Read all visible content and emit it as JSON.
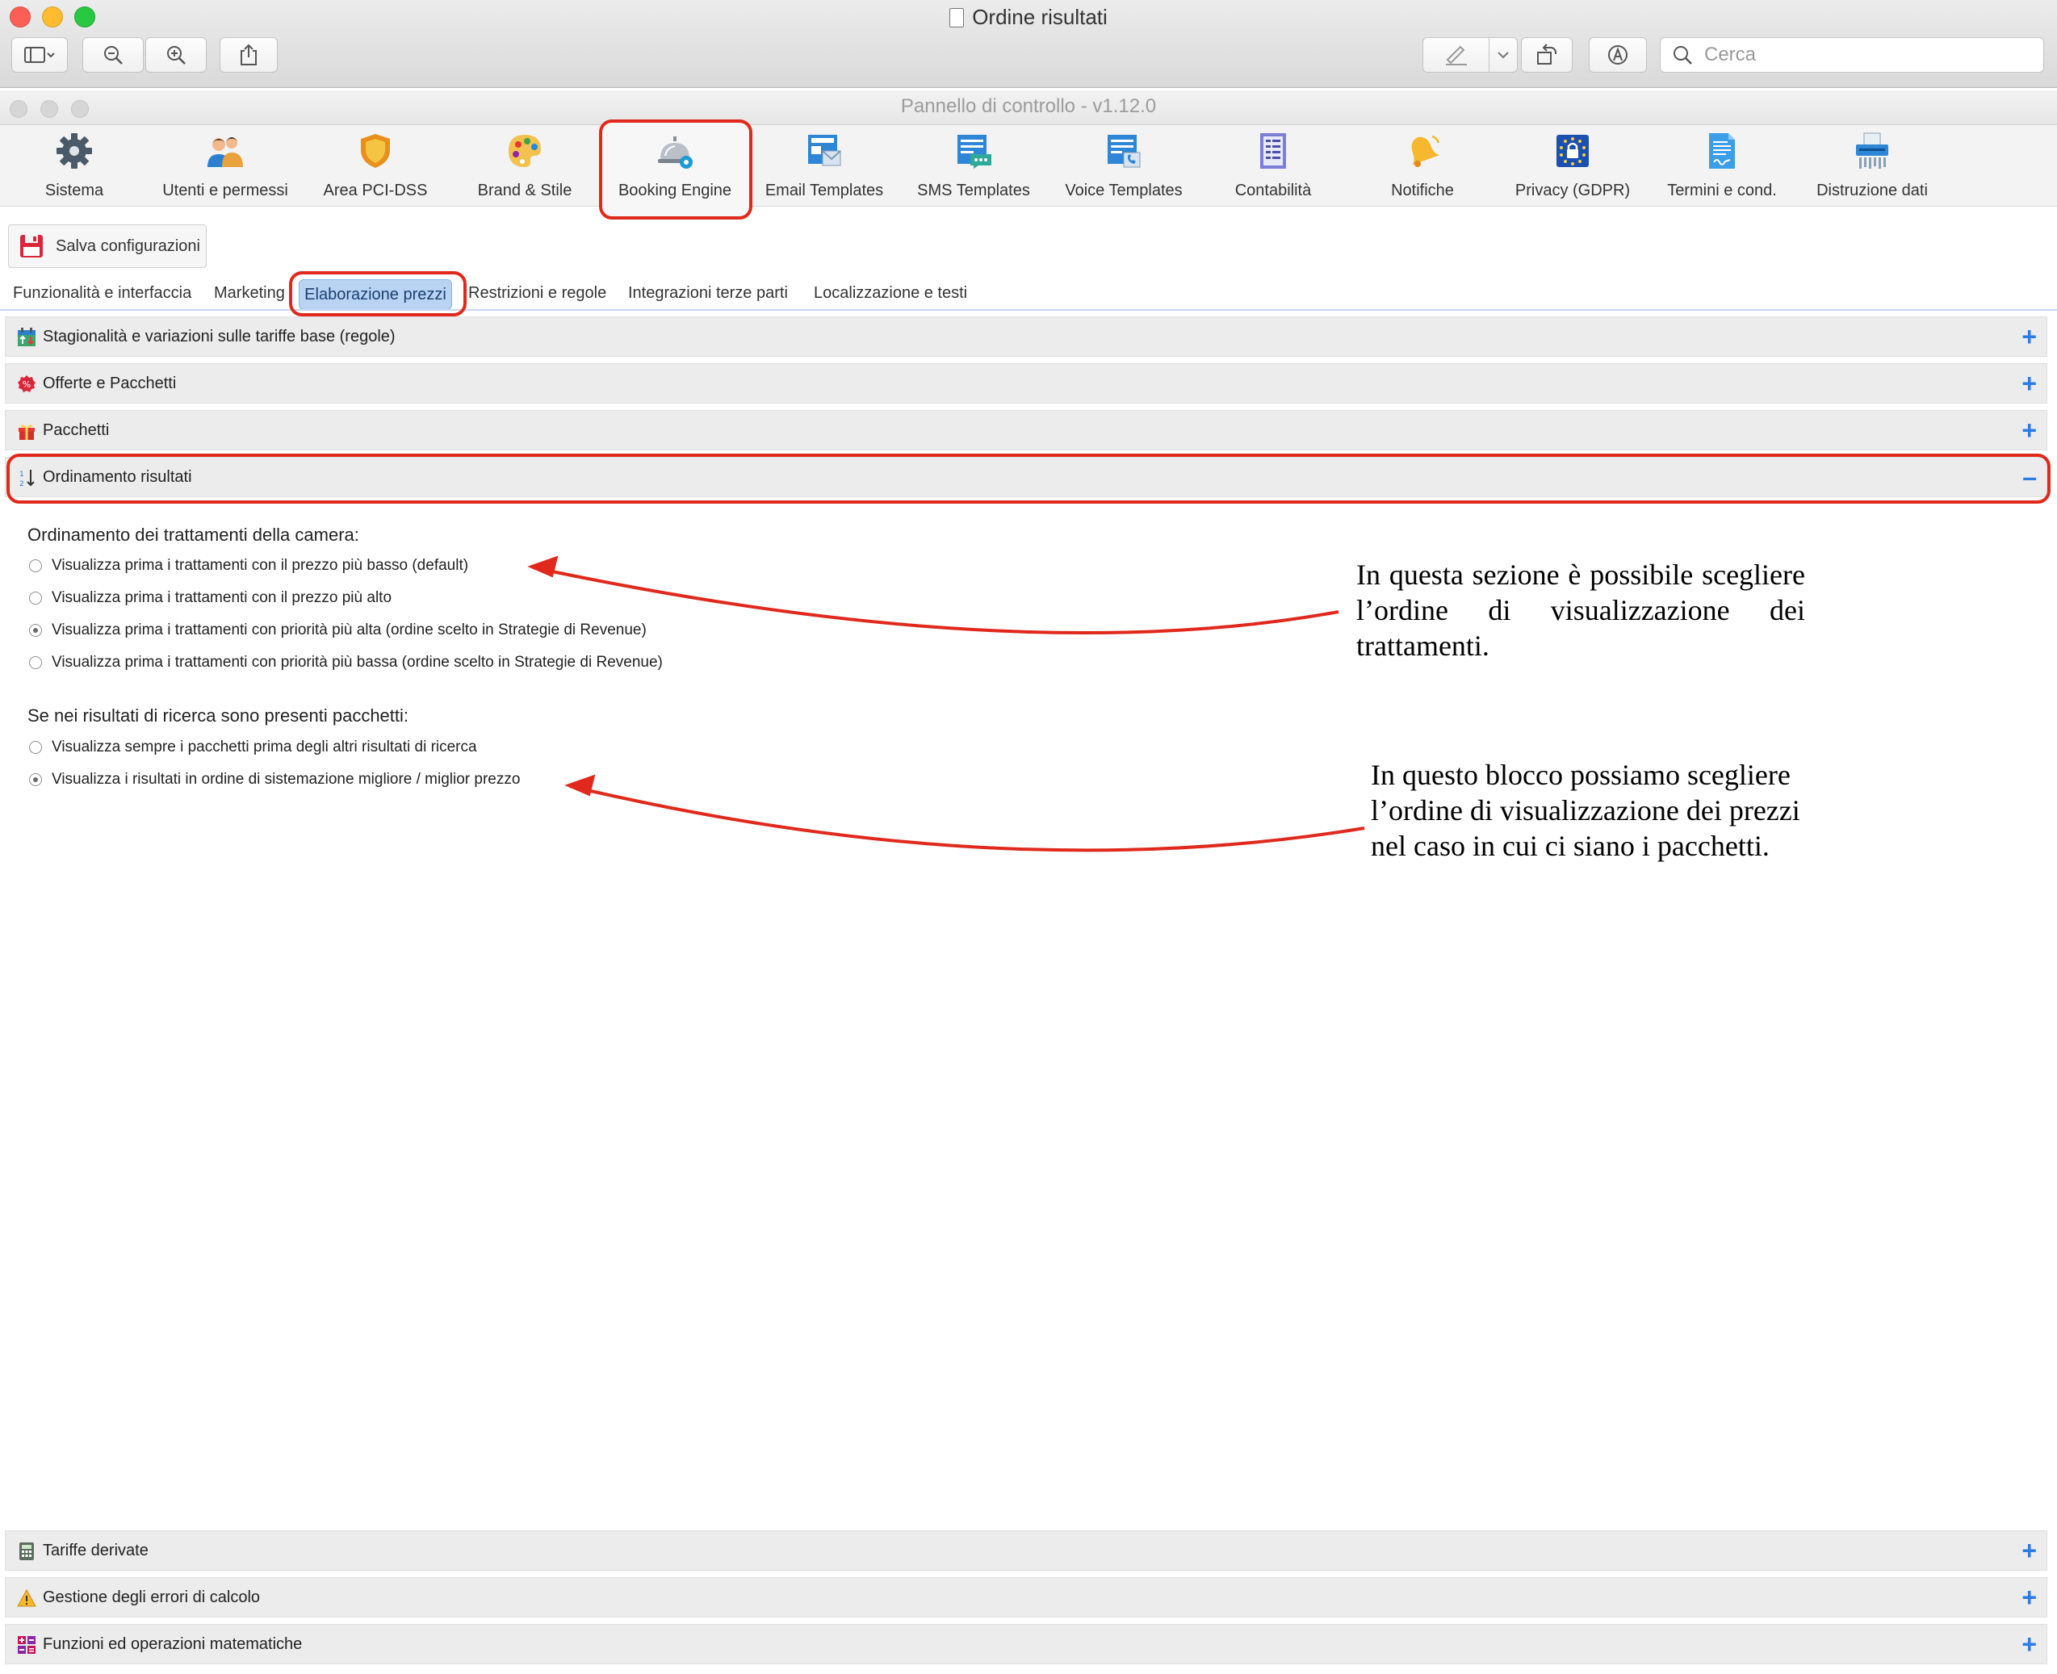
{
  "window": {
    "title": "Ordine risultati",
    "search_placeholder": "Cerca"
  },
  "app": {
    "title": "Pannello di controllo - v1.12.0",
    "toolbar": [
      {
        "label": "Sistema",
        "icon": "gear-icon"
      },
      {
        "label": "Utenti e permessi",
        "icon": "users-icon"
      },
      {
        "label": "Area PCI-DSS",
        "icon": "shield-icon"
      },
      {
        "label": "Brand & Stile",
        "icon": "palette-icon"
      },
      {
        "label": "Booking Engine",
        "icon": "service-bell-icon"
      },
      {
        "label": "Email Templates",
        "icon": "email-template-icon"
      },
      {
        "label": "SMS Templates",
        "icon": "sms-template-icon"
      },
      {
        "label": "Voice Templates",
        "icon": "voice-template-icon"
      },
      {
        "label": "Contabilità",
        "icon": "ledger-icon"
      },
      {
        "label": "Notifiche",
        "icon": "bell-icon"
      },
      {
        "label": "Privacy (GDPR)",
        "icon": "gdpr-lock-icon"
      },
      {
        "label": "Termini e cond.",
        "icon": "document-icon"
      },
      {
        "label": "Distruzione dati",
        "icon": "shredder-icon"
      }
    ],
    "save_label": "Salva configurazioni",
    "tabs": [
      "Funzionalità e interfaccia",
      "Marketing",
      "Elaborazione prezzi",
      "Restrizioni e regole",
      "Integrazioni terze parti",
      "Localizzazione e testi"
    ],
    "active_tab": "Elaborazione prezzi",
    "sections_top": [
      {
        "label": "Stagionalità e variazioni sulle tariffe base (regole)",
        "icon": "calendar-arrows-icon",
        "toggle": "+"
      },
      {
        "label": "Offerte e Pacchetti",
        "icon": "percent-badge-icon",
        "toggle": "+"
      },
      {
        "label": "Pacchetti",
        "icon": "gift-icon",
        "toggle": "+"
      },
      {
        "label": "Ordinamento risultati",
        "icon": "sort-numeric-icon",
        "toggle": "–"
      }
    ],
    "sort_section": {
      "group1_title": "Ordinamento dei trattamenti della camera:",
      "group1_options": [
        {
          "label": "Visualizza prima i trattamenti con il prezzo più basso (default)",
          "selected": false
        },
        {
          "label": "Visualizza prima i trattamenti con il prezzo più alto",
          "selected": false
        },
        {
          "label": "Visualizza prima i trattamenti con priorità più alta (ordine scelto in Strategie di Revenue)",
          "selected": true
        },
        {
          "label": "Visualizza prima i trattamenti con priorità più bassa (ordine scelto in Strategie di Revenue)",
          "selected": false
        }
      ],
      "group2_title": "Se nei risultati di ricerca sono presenti pacchetti:",
      "group2_options": [
        {
          "label": "Visualizza sempre i pacchetti prima degli altri risultati di ricerca",
          "selected": false
        },
        {
          "label": "Visualizza i risultati in ordine di sistemazione migliore / miglior prezzo",
          "selected": true
        }
      ]
    },
    "sections_bottom": [
      {
        "label": "Tariffe derivate",
        "icon": "calculator-icon",
        "toggle": "+"
      },
      {
        "label": "Gestione degli errori di calcolo",
        "icon": "warning-icon",
        "toggle": "+"
      },
      {
        "label": "Funzioni ed operazioni matematiche",
        "icon": "math-grid-icon",
        "toggle": "+"
      }
    ]
  },
  "annotations": {
    "note1": "In questa sezione è possibile scegliere l’ordine di visualizzazione dei trattamenti.",
    "note2": "In questo blocco possiamo scegliere l’ordine di visualizzazione dei prezzi nel caso in cui ci siano i pacchetti.",
    "highlight_color": "#e0291c"
  }
}
